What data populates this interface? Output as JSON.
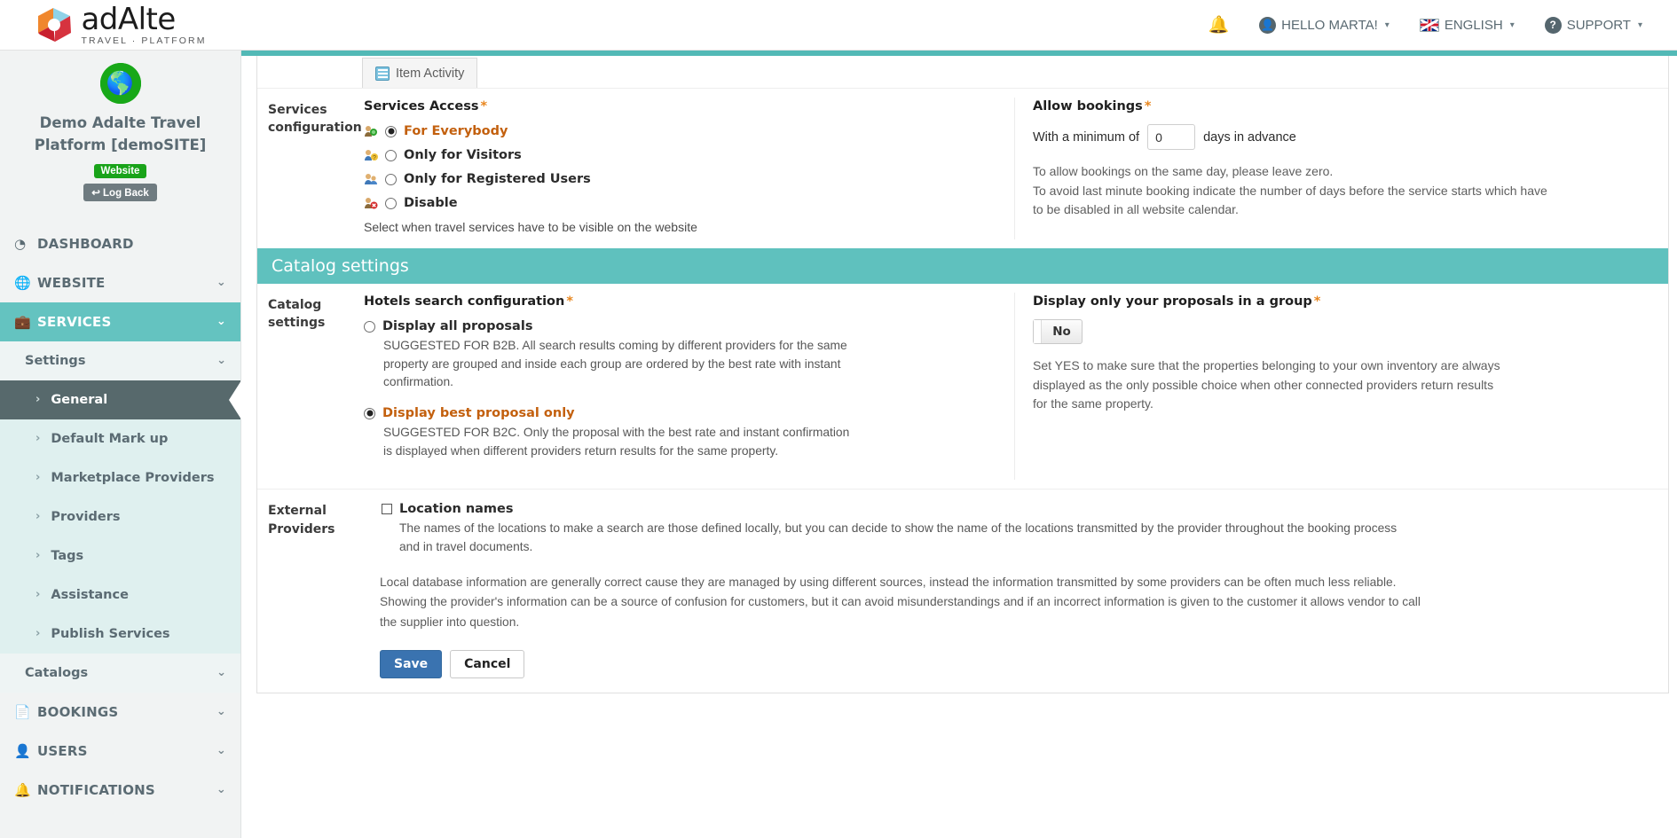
{
  "header": {
    "logo_main": "adAlte",
    "logo_sub": "TRAVEL · PLATFORM",
    "bell_icon": "bell-icon",
    "user_menu": "HELLO MARTA!",
    "language": "ENGLISH",
    "support": "SUPPORT",
    "caret": "▾"
  },
  "sidebar": {
    "globe_icon": "globe-icon",
    "site_title": "Demo Adalte Travel Platform [demoSITE]",
    "website_badge": "Website",
    "logback_badge": "Log Back",
    "logback_icon": "↩",
    "nav": [
      {
        "label": "DASHBOARD",
        "icon": "dashboard-icon",
        "glyph": "◉",
        "chevron": "",
        "active": false
      },
      {
        "label": "WEBSITE",
        "icon": "globe-icon",
        "glyph": "✹",
        "chevron": "⌄",
        "active": false
      },
      {
        "label": "SERVICES",
        "icon": "briefcase-icon",
        "glyph": "▮",
        "chevron": "⌄",
        "active": true
      }
    ],
    "settings_group": "Settings",
    "settings_items": [
      {
        "label": "General",
        "selected": true
      },
      {
        "label": "Default Mark up",
        "selected": false
      },
      {
        "label": "Marketplace Providers",
        "selected": false
      },
      {
        "label": "Providers",
        "selected": false
      },
      {
        "label": "Tags",
        "selected": false
      },
      {
        "label": "Assistance",
        "selected": false
      },
      {
        "label": "Publish Services",
        "selected": false
      }
    ],
    "catalogs_group": "Catalogs",
    "nav_bottom": [
      {
        "label": "BOOKINGS",
        "icon": "document-icon",
        "glyph": "▤",
        "chevron": "⌄"
      },
      {
        "label": "USERS",
        "icon": "user-icon",
        "glyph": "♟",
        "chevron": "⌄"
      },
      {
        "label": "NOTIFICATIONS",
        "icon": "bell-icon",
        "glyph": "🔔",
        "chevron": "⌄"
      }
    ]
  },
  "main": {
    "tab": {
      "label": "Item Activity",
      "icon": "activity-icon"
    },
    "services_config": {
      "row_label": "Services configuration",
      "access_title": "Services Access",
      "required_mark": "*",
      "options": [
        {
          "label": "For Everybody",
          "icon": "people-green-icon",
          "selected": true
        },
        {
          "label": "Only for Visitors",
          "icon": "people-question-icon",
          "selected": false
        },
        {
          "label": "Only for Registered Users",
          "icon": "people-user-icon",
          "selected": false
        },
        {
          "label": "Disable",
          "icon": "people-disabled-icon",
          "selected": false
        }
      ],
      "helper": "Select when travel services have to be visible on the website",
      "allow_bookings_title": "Allow bookings",
      "min_prefix": "With a minimum of",
      "min_value": "0",
      "min_suffix": "days in advance",
      "note_line1": "To allow bookings on the same day, please leave zero.",
      "note_line2": "To avoid last minute booking indicate the number of days before the service starts which have",
      "note_line3": "to be disabled in all website calendar."
    },
    "catalog_section_title": "Catalog settings",
    "catalog_settings": {
      "row_label": "Catalog settings",
      "hotels_title": "Hotels search configuration",
      "required_mark": "*",
      "options": [
        {
          "label": "Display all proposals",
          "selected": false,
          "desc": "SUGGESTED FOR B2B. All search results coming by different providers for the same property are grouped and inside each group are ordered by the best rate with instant confirmation."
        },
        {
          "label": "Display best proposal only",
          "selected": true,
          "desc": "SUGGESTED FOR B2C. Only the proposal with the best rate and instant confirmation is displayed when different providers return results for the same property."
        }
      ],
      "group_title": "Display only your proposals in a group",
      "toggle_value": "No",
      "group_desc": "Set YES to make sure that the properties belonging to your own inventory are always displayed as the only possible choice when other connected providers return results for the same property."
    },
    "external_providers": {
      "row_label": "External Providers",
      "checkbox_label": "Location names",
      "checked": false,
      "desc_line1": "The names of the locations to make a search are those defined locally, but you can decide to show the name of the locations transmitted by the provider throughout the booking process",
      "desc_line2": "and in travel documents.",
      "long_note_1": "Local database information are generally correct cause they are managed by using different sources, instead the information transmitted by some providers can be often much less reliable.",
      "long_note_2": "Showing the provider's information can be a source of confusion for customers, but it can avoid misunderstandings and if an incorrect information is given to the customer it allows vendor to call",
      "long_note_3": "the supplier into question."
    },
    "actions": {
      "save": "Save",
      "cancel": "Cancel"
    }
  },
  "colors": {
    "teal": "#5fc1be",
    "teal_bar": "#52b9b6",
    "sidebar_bg": "#f1f3f3",
    "selected_dark": "#57696c",
    "accent_orange": "#c3600e",
    "required_orange": "#e8861e",
    "save_blue": "#3a73b0",
    "green": "#19a319"
  }
}
